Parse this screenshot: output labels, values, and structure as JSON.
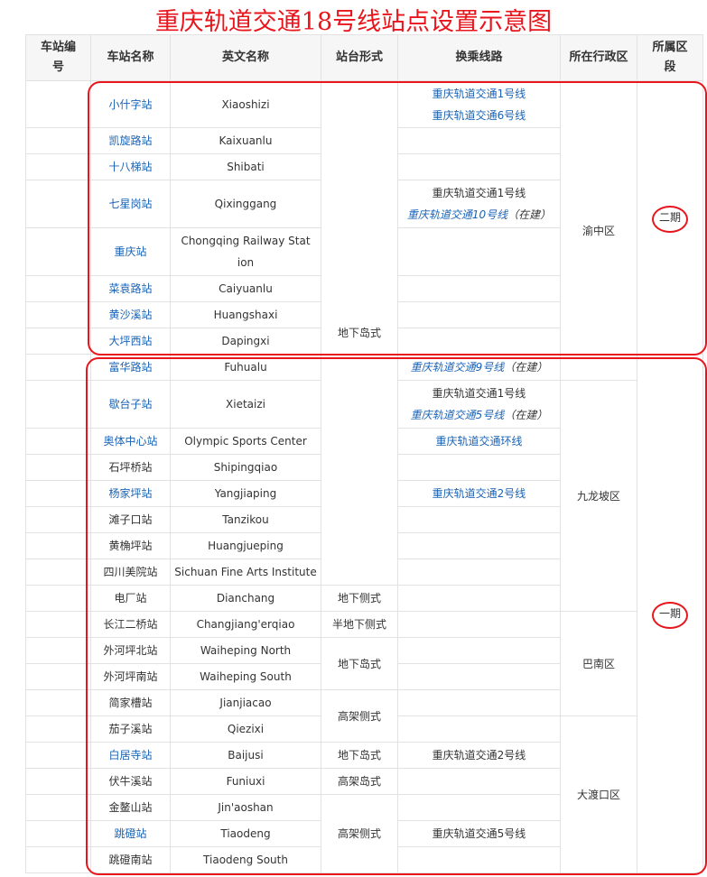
{
  "title": "重庆轨道交通18号线站点设置示意图",
  "headers": [
    "车站编号",
    "车站名称",
    "英文名称",
    "站台形式",
    "换乘线路",
    "所在行政区",
    "所属区段"
  ],
  "stations": [
    {
      "cn": "小什字站",
      "en": "Xiaoshizi",
      "link": true
    },
    {
      "cn": "凯旋路站",
      "en": "Kaixuanlu",
      "link": true
    },
    {
      "cn": "十八梯站",
      "en": "Shibati",
      "link": true
    },
    {
      "cn": "七星岗站",
      "en": "Qixinggang",
      "link": true
    },
    {
      "cn": "重庆站",
      "en": "Chongqing Railway Station",
      "link": true
    },
    {
      "cn": "菜袁路站",
      "en": "Caiyuanlu",
      "link": true
    },
    {
      "cn": "黄沙溪站",
      "en": "Huangshaxi",
      "link": true
    },
    {
      "cn": "大坪西站",
      "en": "Dapingxi",
      "link": true
    },
    {
      "cn": "富华路站",
      "en": "Fuhualu",
      "link": true
    },
    {
      "cn": "歇台子站",
      "en": "Xietaizi",
      "link": true
    },
    {
      "cn": "奥体中心站",
      "en": "Olympic Sports Center",
      "link": true
    },
    {
      "cn": "石坪桥站",
      "en": "Shipingqiao",
      "link": false
    },
    {
      "cn": "杨家坪站",
      "en": "Yangjiaping",
      "link": true
    },
    {
      "cn": "滩子口站",
      "en": "Tanzikou",
      "link": false
    },
    {
      "cn": "黄桷坪站",
      "en": "Huangjueping",
      "link": false
    },
    {
      "cn": "四川美院站",
      "en": "Sichuan Fine Arts Institute",
      "link": false
    },
    {
      "cn": "电厂站",
      "en": "Dianchang",
      "link": false
    },
    {
      "cn": "长江二桥站",
      "en": "Changjiang'erqiao",
      "link": false
    },
    {
      "cn": "外河坪北站",
      "en": "Waiheping North",
      "link": false
    },
    {
      "cn": "外河坪南站",
      "en": "Waiheping South",
      "link": false
    },
    {
      "cn": "简家槽站",
      "en": "Jianjiacao",
      "link": false
    },
    {
      "cn": "茄子溪站",
      "en": "Qiezixi",
      "link": false
    },
    {
      "cn": "白居寺站",
      "en": "Baijusi",
      "link": true
    },
    {
      "cn": "伏牛溪站",
      "en": "Funiuxi",
      "link": false
    },
    {
      "cn": "金鳌山站",
      "en": "Jin'aoshan",
      "link": false
    },
    {
      "cn": "跳磴站",
      "en": "Tiaodeng",
      "link": true
    },
    {
      "cn": "跳磴南站",
      "en": "Tiaodeng South",
      "link": false
    }
  ],
  "platform": [
    {
      "start": 0,
      "span": 16,
      "text": "地下岛式"
    },
    {
      "start": 16,
      "span": 1,
      "text": "地下侧式"
    },
    {
      "start": 17,
      "span": 1,
      "text": "半地下侧式"
    },
    {
      "start": 18,
      "span": 2,
      "text": "地下岛式"
    },
    {
      "start": 20,
      "span": 2,
      "text": "高架侧式"
    },
    {
      "start": 22,
      "span": 1,
      "text": "地下岛式"
    },
    {
      "start": 23,
      "span": 1,
      "text": "高架岛式"
    },
    {
      "start": 24,
      "span": 3,
      "text": "高架侧式"
    }
  ],
  "transfers": {
    "0": [
      {
        "t": "重庆轨道交通1号线",
        "link": true
      },
      {
        "t": "重庆轨道交通6号线",
        "link": true
      }
    ],
    "3": [
      {
        "t": "重庆轨道交通1号线"
      },
      {
        "t": "重庆轨道交通10号线",
        "note": "（在建）",
        "italic": true
      }
    ],
    "8": [
      {
        "t": "重庆轨道交通9号线",
        "note": "（在建）",
        "italic": true
      }
    ],
    "9": [
      {
        "t": "重庆轨道交通1号线"
      },
      {
        "t": "重庆轨道交通5号线",
        "note": "（在建）",
        "italic": true
      }
    ],
    "10": [
      {
        "t": "重庆轨道交通环线",
        "link": true
      }
    ],
    "12": [
      {
        "t": "重庆轨道交通2号线",
        "link": true
      }
    ],
    "22": [
      {
        "t": "重庆轨道交通2号线"
      }
    ],
    "25": [
      {
        "t": "重庆轨道交通5号线"
      }
    ]
  },
  "districts": [
    {
      "start": 0,
      "span": 9,
      "text": "渝中区"
    },
    {
      "start": 9,
      "span": 8,
      "text": "九龙坡区"
    },
    {
      "start": 17,
      "span": 4,
      "text": "巴南区"
    },
    {
      "start": 21,
      "span": 6,
      "text": "大渡口区"
    }
  ],
  "segments": [
    {
      "start": 0,
      "span": 8,
      "text": "二期"
    },
    {
      "start": 8,
      "span": 19,
      "text": "一期"
    }
  ],
  "accent": "#e8161c",
  "link_color": "#1a63b5"
}
